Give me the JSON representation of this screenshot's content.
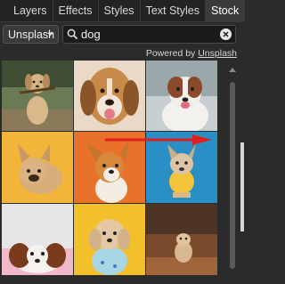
{
  "tabs": [
    "Layers",
    "Effects",
    "Styles",
    "Text Styles",
    "Stock"
  ],
  "active_tab": "Stock",
  "source": {
    "selected": "Unsplash"
  },
  "search": {
    "value": "dog",
    "placeholder": ""
  },
  "powered": {
    "prefix": "Powered by",
    "link": "Unsplash"
  },
  "images": [
    {
      "subject": "dog-with-stick"
    },
    {
      "subject": "beagle-closeup"
    },
    {
      "subject": "border-collie"
    },
    {
      "subject": "french-bulldog-yellow"
    },
    {
      "subject": "corgi-orange"
    },
    {
      "subject": "puppy-blue"
    },
    {
      "subject": "cavalier-puppy"
    },
    {
      "subject": "toy-poodle-shirt"
    },
    {
      "subject": "small-dog-running"
    }
  ],
  "annotation": {
    "type": "red-arrow",
    "color": "#e0201c"
  }
}
